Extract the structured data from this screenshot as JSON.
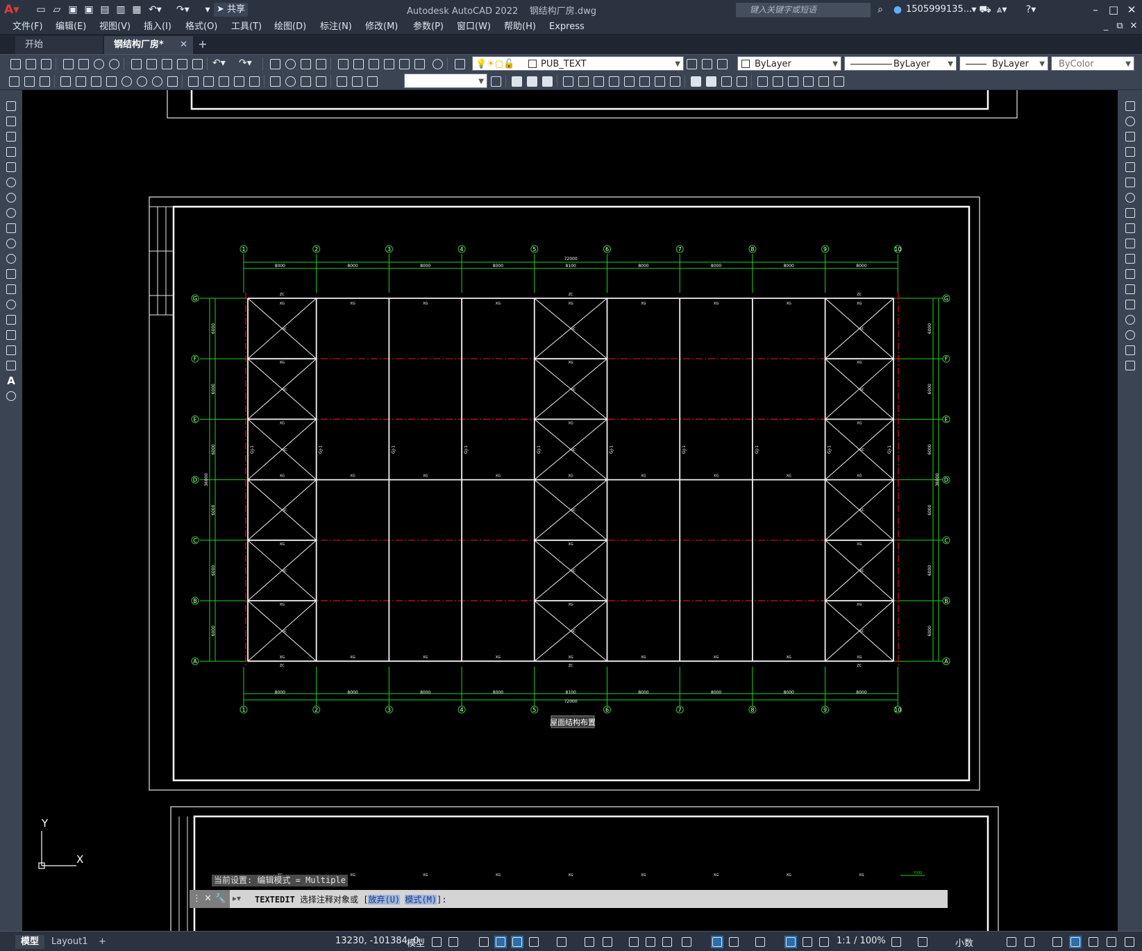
{
  "title": {
    "app_name": "Autodesk AutoCAD 2022",
    "doc_name": "钢结构厂房.dwg",
    "search_placeholder": "键入关键字或短语",
    "user": "1505999135...",
    "share": "共享"
  },
  "menu": [
    "文件(F)",
    "编辑(E)",
    "视图(V)",
    "插入(I)",
    "格式(O)",
    "工具(T)",
    "绘图(D)",
    "标注(N)",
    "修改(M)",
    "参数(P)",
    "窗口(W)",
    "帮助(H)",
    "Express"
  ],
  "tabs": [
    {
      "label": "开始",
      "active": false
    },
    {
      "label": "钢结构厂房*",
      "active": true
    }
  ],
  "toolbar": {
    "layer": "PUB_TEXT",
    "color": "ByLayer",
    "linetype": "ByLayer",
    "lineweight": "ByLayer",
    "plotstyle": "ByColor"
  },
  "drawing": {
    "axis_top": [
      "1",
      "2",
      "3",
      "4",
      "5",
      "6",
      "7",
      "8",
      "9",
      "10"
    ],
    "axis_side": [
      "G",
      "F",
      "E",
      "D",
      "C",
      "B",
      "A"
    ],
    "bay_dims_top": [
      "8000",
      "8000",
      "8000",
      "8000",
      "8100",
      "8000",
      "8000",
      "8000",
      "8000"
    ],
    "bay_dims_bottom": [
      "8000",
      "8000",
      "8000",
      "8000",
      "8100",
      "8000",
      "8000",
      "8000",
      "8000"
    ],
    "overall_dim_top": "72000",
    "overall_dim_bottom": "72000",
    "side_dims": [
      "6000",
      "6000",
      "6000",
      "6000",
      "6000",
      "6000"
    ],
    "overall_side_dim": "36000",
    "plan_title": "屋面结构布置",
    "frame_label": "GJ-1",
    "member_label_top": "XG",
    "member_label_bottom": "XG",
    "brace_label": "SC",
    "tie_label": "ZC",
    "small_dim": "7000"
  },
  "ucs": {
    "x": "X",
    "y": "Y"
  },
  "command": {
    "history": "当前设置: 编辑模式 = Multiple",
    "prompt_cmd": "TEXTEDIT",
    "prompt_text": " 选择注释对象或 [",
    "opt1": "放弃(U)",
    "opt2": "模式(M)",
    "prompt_end": "]:"
  },
  "status": {
    "coords": "13230, -101384, 0",
    "space": "模型",
    "scale": "1:1 / 100%",
    "units": "小数"
  },
  "layout_tabs": [
    "模型",
    "Layout1"
  ],
  "colors": {
    "axis_green": "#1fd31f",
    "beam_white": "#f2f2f2",
    "purlin_red": "#d41515",
    "ui_dark": "#2b3341",
    "ui_mid": "#3b4453"
  }
}
